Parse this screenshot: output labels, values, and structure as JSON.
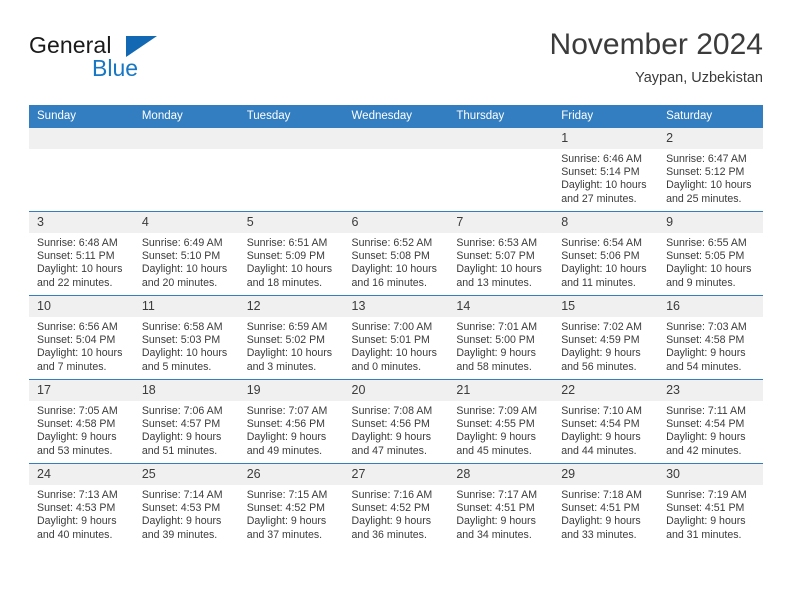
{
  "brand": {
    "name_part1": "General",
    "name_part2": "Blue",
    "logo_icon": "triangle-flag-icon",
    "accent_color": "#1877c4",
    "flag_color": "#1268b3"
  },
  "header": {
    "month_title": "November 2024",
    "location": "Yaypan, Uzbekistan"
  },
  "calendar": {
    "header_color": "#337ec1",
    "daynum_band_color": "#f0f0f0",
    "weekdays": [
      "Sunday",
      "Monday",
      "Tuesday",
      "Wednesday",
      "Thursday",
      "Friday",
      "Saturday"
    ],
    "weeks": [
      [
        {
          "day": "",
          "empty": true
        },
        {
          "day": "",
          "empty": true
        },
        {
          "day": "",
          "empty": true
        },
        {
          "day": "",
          "empty": true
        },
        {
          "day": "",
          "empty": true
        },
        {
          "day": "1",
          "sunrise": "Sunrise: 6:46 AM",
          "sunset": "Sunset: 5:14 PM",
          "daylight": "Daylight: 10 hours and 27 minutes."
        },
        {
          "day": "2",
          "sunrise": "Sunrise: 6:47 AM",
          "sunset": "Sunset: 5:12 PM",
          "daylight": "Daylight: 10 hours and 25 minutes."
        }
      ],
      [
        {
          "day": "3",
          "sunrise": "Sunrise: 6:48 AM",
          "sunset": "Sunset: 5:11 PM",
          "daylight": "Daylight: 10 hours and 22 minutes."
        },
        {
          "day": "4",
          "sunrise": "Sunrise: 6:49 AM",
          "sunset": "Sunset: 5:10 PM",
          "daylight": "Daylight: 10 hours and 20 minutes."
        },
        {
          "day": "5",
          "sunrise": "Sunrise: 6:51 AM",
          "sunset": "Sunset: 5:09 PM",
          "daylight": "Daylight: 10 hours and 18 minutes."
        },
        {
          "day": "6",
          "sunrise": "Sunrise: 6:52 AM",
          "sunset": "Sunset: 5:08 PM",
          "daylight": "Daylight: 10 hours and 16 minutes."
        },
        {
          "day": "7",
          "sunrise": "Sunrise: 6:53 AM",
          "sunset": "Sunset: 5:07 PM",
          "daylight": "Daylight: 10 hours and 13 minutes."
        },
        {
          "day": "8",
          "sunrise": "Sunrise: 6:54 AM",
          "sunset": "Sunset: 5:06 PM",
          "daylight": "Daylight: 10 hours and 11 minutes."
        },
        {
          "day": "9",
          "sunrise": "Sunrise: 6:55 AM",
          "sunset": "Sunset: 5:05 PM",
          "daylight": "Daylight: 10 hours and 9 minutes."
        }
      ],
      [
        {
          "day": "10",
          "sunrise": "Sunrise: 6:56 AM",
          "sunset": "Sunset: 5:04 PM",
          "daylight": "Daylight: 10 hours and 7 minutes."
        },
        {
          "day": "11",
          "sunrise": "Sunrise: 6:58 AM",
          "sunset": "Sunset: 5:03 PM",
          "daylight": "Daylight: 10 hours and 5 minutes."
        },
        {
          "day": "12",
          "sunrise": "Sunrise: 6:59 AM",
          "sunset": "Sunset: 5:02 PM",
          "daylight": "Daylight: 10 hours and 3 minutes."
        },
        {
          "day": "13",
          "sunrise": "Sunrise: 7:00 AM",
          "sunset": "Sunset: 5:01 PM",
          "daylight": "Daylight: 10 hours and 0 minutes."
        },
        {
          "day": "14",
          "sunrise": "Sunrise: 7:01 AM",
          "sunset": "Sunset: 5:00 PM",
          "daylight": "Daylight: 9 hours and 58 minutes."
        },
        {
          "day": "15",
          "sunrise": "Sunrise: 7:02 AM",
          "sunset": "Sunset: 4:59 PM",
          "daylight": "Daylight: 9 hours and 56 minutes."
        },
        {
          "day": "16",
          "sunrise": "Sunrise: 7:03 AM",
          "sunset": "Sunset: 4:58 PM",
          "daylight": "Daylight: 9 hours and 54 minutes."
        }
      ],
      [
        {
          "day": "17",
          "sunrise": "Sunrise: 7:05 AM",
          "sunset": "Sunset: 4:58 PM",
          "daylight": "Daylight: 9 hours and 53 minutes."
        },
        {
          "day": "18",
          "sunrise": "Sunrise: 7:06 AM",
          "sunset": "Sunset: 4:57 PM",
          "daylight": "Daylight: 9 hours and 51 minutes."
        },
        {
          "day": "19",
          "sunrise": "Sunrise: 7:07 AM",
          "sunset": "Sunset: 4:56 PM",
          "daylight": "Daylight: 9 hours and 49 minutes."
        },
        {
          "day": "20",
          "sunrise": "Sunrise: 7:08 AM",
          "sunset": "Sunset: 4:56 PM",
          "daylight": "Daylight: 9 hours and 47 minutes."
        },
        {
          "day": "21",
          "sunrise": "Sunrise: 7:09 AM",
          "sunset": "Sunset: 4:55 PM",
          "daylight": "Daylight: 9 hours and 45 minutes."
        },
        {
          "day": "22",
          "sunrise": "Sunrise: 7:10 AM",
          "sunset": "Sunset: 4:54 PM",
          "daylight": "Daylight: 9 hours and 44 minutes."
        },
        {
          "day": "23",
          "sunrise": "Sunrise: 7:11 AM",
          "sunset": "Sunset: 4:54 PM",
          "daylight": "Daylight: 9 hours and 42 minutes."
        }
      ],
      [
        {
          "day": "24",
          "sunrise": "Sunrise: 7:13 AM",
          "sunset": "Sunset: 4:53 PM",
          "daylight": "Daylight: 9 hours and 40 minutes."
        },
        {
          "day": "25",
          "sunrise": "Sunrise: 7:14 AM",
          "sunset": "Sunset: 4:53 PM",
          "daylight": "Daylight: 9 hours and 39 minutes."
        },
        {
          "day": "26",
          "sunrise": "Sunrise: 7:15 AM",
          "sunset": "Sunset: 4:52 PM",
          "daylight": "Daylight: 9 hours and 37 minutes."
        },
        {
          "day": "27",
          "sunrise": "Sunrise: 7:16 AM",
          "sunset": "Sunset: 4:52 PM",
          "daylight": "Daylight: 9 hours and 36 minutes."
        },
        {
          "day": "28",
          "sunrise": "Sunrise: 7:17 AM",
          "sunset": "Sunset: 4:51 PM",
          "daylight": "Daylight: 9 hours and 34 minutes."
        },
        {
          "day": "29",
          "sunrise": "Sunrise: 7:18 AM",
          "sunset": "Sunset: 4:51 PM",
          "daylight": "Daylight: 9 hours and 33 minutes."
        },
        {
          "day": "30",
          "sunrise": "Sunrise: 7:19 AM",
          "sunset": "Sunset: 4:51 PM",
          "daylight": "Daylight: 9 hours and 31 minutes."
        }
      ]
    ]
  }
}
